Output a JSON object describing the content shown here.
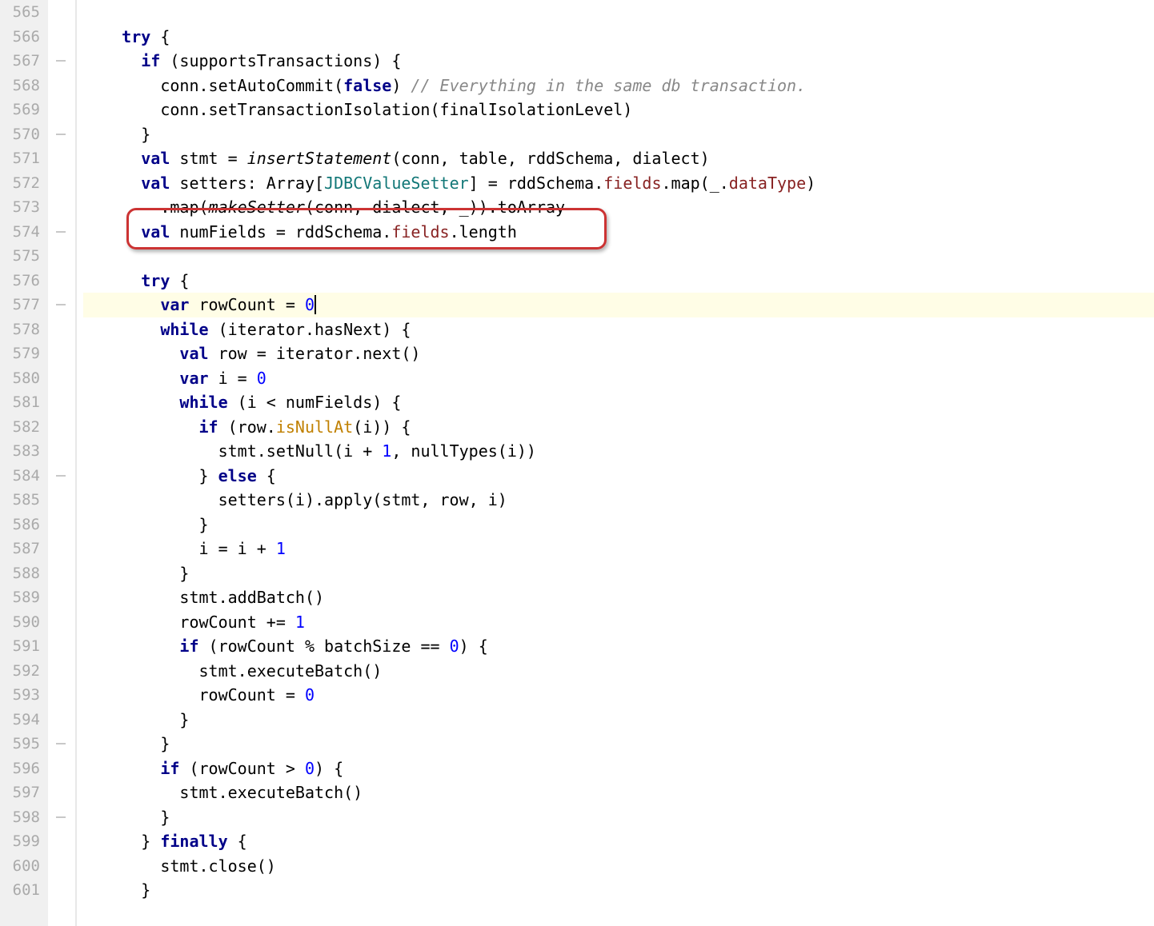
{
  "first_line": 565,
  "last_line": 601,
  "highlighted_line": 577,
  "callout_line": 574,
  "fold_marks_at": [
    567,
    570,
    574,
    577,
    584,
    595,
    598
  ],
  "code_lines": {
    "565": [
      {
        "t": "",
        "cls": "txt"
      }
    ],
    "566": [
      {
        "t": "    ",
        "cls": "txt"
      },
      {
        "t": "try",
        "cls": "kw"
      },
      {
        "t": " {",
        "cls": "txt"
      }
    ],
    "567": [
      {
        "t": "      ",
        "cls": "txt"
      },
      {
        "t": "if",
        "cls": "kw"
      },
      {
        "t": " (supportsTransactions) {",
        "cls": "txt"
      }
    ],
    "568": [
      {
        "t": "        conn.setAutoCommit(",
        "cls": "txt"
      },
      {
        "t": "false",
        "cls": "false-lit"
      },
      {
        "t": ") ",
        "cls": "txt"
      },
      {
        "t": "// Everything in the same db transaction.",
        "cls": "comment"
      }
    ],
    "569": [
      {
        "t": "        conn.setTransactionIsolation(finalIsolationLevel)",
        "cls": "txt"
      }
    ],
    "570": [
      {
        "t": "      }",
        "cls": "txt"
      }
    ],
    "571": [
      {
        "t": "      ",
        "cls": "txt"
      },
      {
        "t": "val",
        "cls": "kw"
      },
      {
        "t": " stmt = ",
        "cls": "txt"
      },
      {
        "t": "insertStatement",
        "cls": "method-italic"
      },
      {
        "t": "(conn, table, rddSchema, dialect)",
        "cls": "txt"
      }
    ],
    "572": [
      {
        "t": "      ",
        "cls": "txt"
      },
      {
        "t": "val",
        "cls": "kw"
      },
      {
        "t": " setters: Array[",
        "cls": "txt"
      },
      {
        "t": "JDBCValueSetter",
        "cls": "type-teal"
      },
      {
        "t": "] = rddSchema.",
        "cls": "txt"
      },
      {
        "t": "fields",
        "cls": "field-red"
      },
      {
        "t": ".map(_.",
        "cls": "txt"
      },
      {
        "t": "dataType",
        "cls": "field-red"
      },
      {
        "t": ")",
        "cls": "txt"
      }
    ],
    "573": [
      {
        "t": "        .map(",
        "cls": "txt"
      },
      {
        "t": "makeSetter",
        "cls": "method-italic"
      },
      {
        "t": "(conn, dialect, _)).toArray",
        "cls": "txt"
      }
    ],
    "574": [
      {
        "t": "      ",
        "cls": "txt"
      },
      {
        "t": "val",
        "cls": "kw"
      },
      {
        "t": " numFields = rddSchema.",
        "cls": "txt"
      },
      {
        "t": "fields",
        "cls": "field-red"
      },
      {
        "t": ".length",
        "cls": "txt"
      }
    ],
    "575": [
      {
        "t": "",
        "cls": "txt"
      }
    ],
    "576": [
      {
        "t": "      ",
        "cls": "txt"
      },
      {
        "t": "try",
        "cls": "kw"
      },
      {
        "t": " {",
        "cls": "txt"
      }
    ],
    "577": [
      {
        "t": "        ",
        "cls": "txt"
      },
      {
        "t": "var",
        "cls": "kw"
      },
      {
        "t": " rowCount = ",
        "cls": "txt"
      },
      {
        "t": "0",
        "cls": "num"
      }
    ],
    "578": [
      {
        "t": "        ",
        "cls": "txt"
      },
      {
        "t": "while",
        "cls": "kw"
      },
      {
        "t": " (iterator.hasNext) {",
        "cls": "txt"
      }
    ],
    "579": [
      {
        "t": "          ",
        "cls": "txt"
      },
      {
        "t": "val",
        "cls": "kw"
      },
      {
        "t": " row = iterator.next()",
        "cls": "txt"
      }
    ],
    "580": [
      {
        "t": "          ",
        "cls": "txt"
      },
      {
        "t": "var",
        "cls": "kw"
      },
      {
        "t": " i = ",
        "cls": "txt"
      },
      {
        "t": "0",
        "cls": "num"
      }
    ],
    "581": [
      {
        "t": "          ",
        "cls": "txt"
      },
      {
        "t": "while",
        "cls": "kw"
      },
      {
        "t": " (i < numFields) {",
        "cls": "txt"
      }
    ],
    "582": [
      {
        "t": "            ",
        "cls": "txt"
      },
      {
        "t": "if",
        "cls": "kw"
      },
      {
        "t": " (row.",
        "cls": "txt"
      },
      {
        "t": "isNullAt",
        "cls": "warn"
      },
      {
        "t": "(i)) {",
        "cls": "txt"
      }
    ],
    "583": [
      {
        "t": "              stmt.setNull(i + ",
        "cls": "txt"
      },
      {
        "t": "1",
        "cls": "num"
      },
      {
        "t": ", nullTypes(i))",
        "cls": "txt"
      }
    ],
    "584": [
      {
        "t": "            } ",
        "cls": "txt"
      },
      {
        "t": "else",
        "cls": "kw"
      },
      {
        "t": " {",
        "cls": "txt"
      }
    ],
    "585": [
      {
        "t": "              setters(i).apply(stmt, row, i)",
        "cls": "txt"
      }
    ],
    "586": [
      {
        "t": "            }",
        "cls": "txt"
      }
    ],
    "587": [
      {
        "t": "            i = i + ",
        "cls": "txt"
      },
      {
        "t": "1",
        "cls": "num"
      }
    ],
    "588": [
      {
        "t": "          }",
        "cls": "txt"
      }
    ],
    "589": [
      {
        "t": "          stmt.addBatch()",
        "cls": "txt"
      }
    ],
    "590": [
      {
        "t": "          rowCount += ",
        "cls": "txt"
      },
      {
        "t": "1",
        "cls": "num"
      }
    ],
    "591": [
      {
        "t": "          ",
        "cls": "txt"
      },
      {
        "t": "if",
        "cls": "kw"
      },
      {
        "t": " (rowCount % batchSize == ",
        "cls": "txt"
      },
      {
        "t": "0",
        "cls": "num"
      },
      {
        "t": ") {",
        "cls": "txt"
      }
    ],
    "592": [
      {
        "t": "            stmt.executeBatch()",
        "cls": "txt"
      }
    ],
    "593": [
      {
        "t": "            rowCount = ",
        "cls": "txt"
      },
      {
        "t": "0",
        "cls": "num"
      }
    ],
    "594": [
      {
        "t": "          }",
        "cls": "txt"
      }
    ],
    "595": [
      {
        "t": "        }",
        "cls": "txt"
      }
    ],
    "596": [
      {
        "t": "        ",
        "cls": "txt"
      },
      {
        "t": "if",
        "cls": "kw"
      },
      {
        "t": " (rowCount > ",
        "cls": "txt"
      },
      {
        "t": "0",
        "cls": "num"
      },
      {
        "t": ") {",
        "cls": "txt"
      }
    ],
    "597": [
      {
        "t": "          stmt.executeBatch()",
        "cls": "txt"
      }
    ],
    "598": [
      {
        "t": "        }",
        "cls": "txt"
      }
    ],
    "599": [
      {
        "t": "      } ",
        "cls": "txt"
      },
      {
        "t": "finally",
        "cls": "kw"
      },
      {
        "t": " {",
        "cls": "txt"
      }
    ],
    "600": [
      {
        "t": "        stmt.close()",
        "cls": "txt"
      }
    ],
    "601": [
      {
        "t": "      }",
        "cls": "txt"
      }
    ]
  }
}
